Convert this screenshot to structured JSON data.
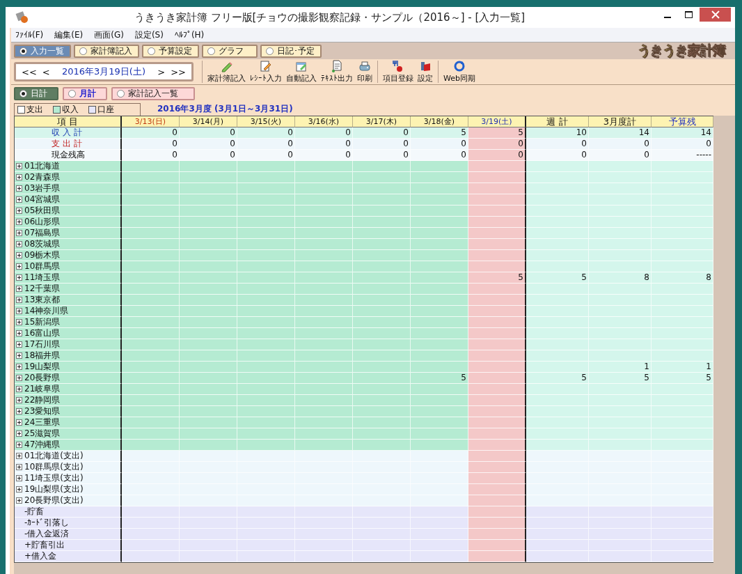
{
  "window": {
    "title": "うきうき家計簿 フリー版[チョウの撮影観察記録・サンプル（2016～] - [入力一覧]"
  },
  "menu": [
    "ﾌｧｲﾙ(F)",
    "編集(E)",
    "画面(G)",
    "設定(S)",
    "ﾍﾙﾌﾟ(H)"
  ],
  "tabs": [
    {
      "label": "入力一覧",
      "selected": true
    },
    {
      "label": "家計簿記入",
      "selected": false
    },
    {
      "label": "予算設定",
      "selected": false
    },
    {
      "label": "グラフ",
      "selected": false
    },
    {
      "label": "日記･予定",
      "selected": false
    }
  ],
  "logo": "うきうき家計簿",
  "date_nav": {
    "first": "<<",
    "prev": "<",
    "date": "2016年3月19日(土)",
    "next": ">",
    "last": ">>"
  },
  "toolbar": [
    {
      "kind": "pencil",
      "label": "家計簿記入"
    },
    {
      "kind": "receipt",
      "label": "ﾚｼｰﾄ入力"
    },
    {
      "kind": "auto",
      "label": "自動記入"
    },
    {
      "kind": "text",
      "label": "ﾃｷｽﾄ出力"
    },
    {
      "kind": "print",
      "label": "印刷"
    },
    {
      "kind": "items",
      "label": "項目登録"
    },
    {
      "kind": "settings",
      "label": "設定"
    },
    {
      "kind": "sync",
      "label": "Web同期"
    }
  ],
  "view_tabs": [
    {
      "label": "日計",
      "selected": true
    },
    {
      "label": "月計",
      "selected": false
    },
    {
      "label": "家計記入一覧",
      "selected": false
    }
  ],
  "legend": [
    {
      "label": "支出",
      "color": "#ffffff"
    },
    {
      "label": "収入",
      "color": "#b5ebd2"
    },
    {
      "label": "口座",
      "color": "#e6e6fa"
    }
  ],
  "period": "2016年3月度 (3月1日～3月31日)",
  "table": {
    "columns": [
      {
        "label": "項 目",
        "kind": "item",
        "selected": false
      },
      {
        "label": "3/13(日)",
        "kind": "sunday",
        "selected": false
      },
      {
        "label": "3/14(月)",
        "kind": "day",
        "selected": false
      },
      {
        "label": "3/15(火)",
        "kind": "day",
        "selected": false
      },
      {
        "label": "3/16(水)",
        "kind": "day",
        "selected": false
      },
      {
        "label": "3/17(木)",
        "kind": "day",
        "selected": false
      },
      {
        "label": "3/18(金)",
        "kind": "day",
        "selected": false
      },
      {
        "label": "3/19(土)",
        "kind": "saturday",
        "selected": true
      },
      {
        "label": "週 計",
        "kind": "total",
        "selected": false
      },
      {
        "label": "3月度計",
        "kind": "total",
        "selected": false
      },
      {
        "label": "予算残",
        "kind": "budget",
        "selected": false
      }
    ],
    "rows": [
      {
        "label": "収入計",
        "kind": "income_total",
        "values": [
          "0",
          "0",
          "0",
          "0",
          "0",
          "5",
          "5",
          "10",
          "14",
          "14"
        ]
      },
      {
        "label": "支出計",
        "kind": "expense_total",
        "values": [
          "0",
          "0",
          "0",
          "0",
          "0",
          "0",
          "0",
          "0",
          "0",
          "0"
        ]
      },
      {
        "label": "現金残高",
        "kind": "balance",
        "values": [
          "0",
          "0",
          "0",
          "0",
          "0",
          "0",
          "0",
          "0",
          "0",
          "-----"
        ]
      },
      {
        "label": "01北海道",
        "kind": "income"
      },
      {
        "label": "02青森県",
        "kind": "income"
      },
      {
        "label": "03岩手県",
        "kind": "income"
      },
      {
        "label": "04宮城県",
        "kind": "income"
      },
      {
        "label": "05秋田県",
        "kind": "income"
      },
      {
        "label": "06山形県",
        "kind": "income"
      },
      {
        "label": "07福島県",
        "kind": "income"
      },
      {
        "label": "08茨城県",
        "kind": "income"
      },
      {
        "label": "09栃木県",
        "kind": "income"
      },
      {
        "label": "10群馬県",
        "kind": "income"
      },
      {
        "label": "11埼玉県",
        "kind": "income",
        "cells": [
          {
            "kind": "blank"
          },
          {
            "kind": "blank"
          },
          {
            "kind": "blank"
          },
          {
            "kind": "blank"
          },
          {
            "kind": "blank"
          },
          {
            "kind": "blank"
          },
          {
            "kind": "value",
            "text": "5"
          },
          {
            "kind": "value",
            "text": "5"
          },
          {
            "kind": "value",
            "text": "8"
          },
          {
            "kind": "value",
            "text": "8"
          }
        ]
      },
      {
        "label": "12千葉県",
        "kind": "income"
      },
      {
        "label": "13東京都",
        "kind": "income"
      },
      {
        "label": "14神奈川県",
        "kind": "income"
      },
      {
        "label": "15新潟県",
        "kind": "income"
      },
      {
        "label": "16富山県",
        "kind": "income"
      },
      {
        "label": "17石川県",
        "kind": "income"
      },
      {
        "label": "18福井県",
        "kind": "income"
      },
      {
        "label": "19山梨県",
        "kind": "income",
        "cells": [
          {
            "kind": "blank"
          },
          {
            "kind": "blank"
          },
          {
            "kind": "blank"
          },
          {
            "kind": "blank"
          },
          {
            "kind": "blank"
          },
          {
            "kind": "blank"
          },
          {
            "kind": "blank"
          },
          {
            "kind": "blank"
          },
          {
            "kind": "value",
            "text": "1"
          },
          {
            "kind": "value",
            "text": "1"
          }
        ]
      },
      {
        "label": "20長野県",
        "kind": "income",
        "cells": [
          {
            "kind": "blank"
          },
          {
            "kind": "blank"
          },
          {
            "kind": "blank"
          },
          {
            "kind": "blank"
          },
          {
            "kind": "blank"
          },
          {
            "kind": "value",
            "text": "5"
          },
          {
            "kind": "blank"
          },
          {
            "kind": "value",
            "text": "5"
          },
          {
            "kind": "value",
            "text": "5"
          },
          {
            "kind": "value",
            "text": "5"
          }
        ]
      },
      {
        "label": "21岐阜県",
        "kind": "income"
      },
      {
        "label": "22静岡県",
        "kind": "income"
      },
      {
        "label": "23愛知県",
        "kind": "income"
      },
      {
        "label": "24三重県",
        "kind": "income"
      },
      {
        "label": "25滋賀県",
        "kind": "income"
      },
      {
        "label": "47沖縄県",
        "kind": "income"
      },
      {
        "label": "01北海道(支出)",
        "kind": "expense"
      },
      {
        "label": "10群馬県(支出)",
        "kind": "expense"
      },
      {
        "label": "11埼玉県(支出)",
        "kind": "expense"
      },
      {
        "label": "19山梨県(支出)",
        "kind": "expense"
      },
      {
        "label": "20長野県(支出)",
        "kind": "expense"
      },
      {
        "label": "-貯畜",
        "kind": "account"
      },
      {
        "label": "-ｶｰﾄﾞ引落し",
        "kind": "account"
      },
      {
        "label": "-借入金返済",
        "kind": "account"
      },
      {
        "label": "+貯畜引出",
        "kind": "account"
      },
      {
        "label": "+借入金",
        "kind": "account"
      }
    ]
  }
}
